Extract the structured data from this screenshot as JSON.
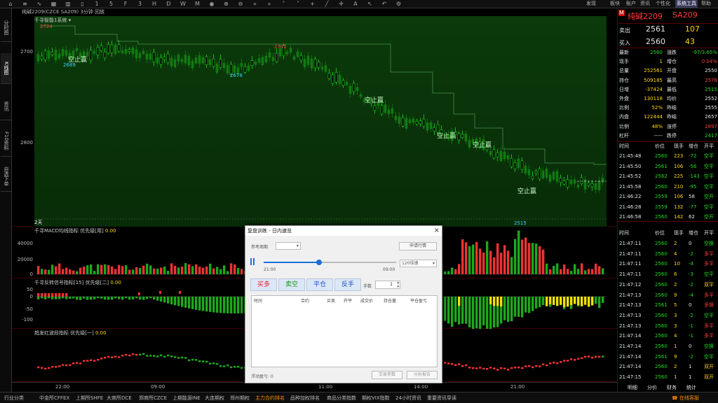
{
  "toolbar": {
    "top_menu": [
      "发现",
      "板块",
      "账户",
      "资讯",
      "个性化",
      "系统工具",
      "帮助"
    ],
    "active_menu": "系统工具"
  },
  "titlebar": {
    "text": "纯碱2209(CZCE SA209)  3分钟  回放"
  },
  "left_tabs": [
    "分时图",
    "K线图",
    "资讯",
    "F10资料",
    "自选下单"
  ],
  "main_pane": {
    "title": "千寻智能1系统",
    "y_ticks": [
      "2700",
      "2800"
    ],
    "period_label": "2天",
    "annotations": [
      {
        "text": "2724",
        "color": "red"
      },
      {
        "text": "2689",
        "color": "cyan"
      },
      {
        "text": "2702",
        "color": "red"
      },
      {
        "text": "2678",
        "color": "cyan"
      },
      {
        "text": "2515",
        "color": "cyan"
      }
    ],
    "trade_labels": [
      "空止赢",
      "空止赢",
      "空止赢",
      "空止赢",
      "空止赢"
    ]
  },
  "macd_pane": {
    "title": "千寻MACD均线指标",
    "suffix": "优先级[用]",
    "value": "0.00",
    "y_ticks": [
      "40000",
      "20000",
      "0"
    ]
  },
  "signal_pane": {
    "title": "千寻反转信号指标[15]",
    "suffix": "优先级[二]",
    "value": "0.00",
    "y_ticks": [
      "50",
      "0",
      "-50",
      "-100"
    ]
  },
  "dist_pane": {
    "title": "趋发红波段指标",
    "suffix": "优先级[一]",
    "value": "0.00"
  },
  "x_axis": [
    "22:00",
    "09:00",
    "11:00",
    "14:00",
    "21:00"
  ],
  "status_bar": {
    "items": [
      "行业分类",
      "中金所CFFEX",
      "上期所SHFE",
      "大商所DCE",
      "郑商所CZCE",
      "上期能源INE",
      "大连期权",
      "郑州期权",
      "主力合约排名",
      "品种加权排名",
      "商品分类指数",
      "期权VIX指数",
      "24小时资讯",
      "重要资讯导读"
    ],
    "highlight": "主力合约排名",
    "right_label": "在线客服"
  },
  "quote": {
    "badge": "M",
    "name": "纯碱2209",
    "code": "SA209",
    "ask_label": "卖出",
    "ask_price": "2561",
    "ask_vol": "107",
    "bid_label": "买入",
    "bid_price": "2560",
    "bid_vol": "43",
    "stats": [
      {
        "l1": "最新",
        "v1": "2560",
        "l2": "涨跌",
        "v2": "-97/3.65%"
      },
      {
        "l1": "现手",
        "v1": "1",
        "l2": "增仓",
        "v2": "0.04%"
      },
      {
        "l1": "总量",
        "v1": "252561",
        "l2": "开盘",
        "v2": "2550"
      },
      {
        "l1": "持仓",
        "v1": "509185",
        "l2": "最高",
        "v2": "2576"
      },
      {
        "l1": "日增",
        "v1": "-37424",
        "l2": "最低",
        "v2": "2515"
      },
      {
        "l1": "外盘",
        "v1": "130118",
        "l2": "均价",
        "v2": "2552"
      },
      {
        "l1": "比例",
        "v1": "52%",
        "l2": "昨结",
        "v2": "2555"
      },
      {
        "l1": "内盘",
        "v1": "122444",
        "l2": "昨结",
        "v2": "2657"
      },
      {
        "l1": "比例",
        "v1": "48%",
        "l2": "涨停",
        "v2": "2897"
      },
      {
        "l1": "杠杆",
        "v1": "-----",
        "l2": "跌停",
        "v2": "2417"
      }
    ],
    "ticks_header": [
      "时间",
      "价位",
      "现手",
      "增仓",
      "开平"
    ],
    "ticks_a": [
      [
        "21:45:48",
        "2560",
        "223",
        "-72",
        "空平"
      ],
      [
        "21:45:50",
        "2561",
        "106",
        "-56",
        "空平"
      ],
      [
        "21:45:52",
        "2562",
        "225",
        "-143",
        "空平"
      ],
      [
        "21:45:58",
        "2560",
        "210",
        "-95",
        "空平"
      ],
      [
        "21:46:22",
        "2559",
        "106",
        "58",
        "空开"
      ],
      [
        "21:46:28",
        "2559",
        "132",
        "-77",
        "空平"
      ],
      [
        "21:46:58",
        "2560",
        "142",
        "62",
        "空开"
      ]
    ],
    "ticks_b": [
      [
        "21:47:11",
        "2560",
        "2",
        "0",
        "空换"
      ],
      [
        "21:47:11",
        "2560",
        "4",
        "-2",
        "多平"
      ],
      [
        "21:47:11",
        "2560",
        "10",
        "-4",
        "多平"
      ],
      [
        "21:47:11",
        "2560",
        "6",
        "-3",
        "空平"
      ],
      [
        "21:47:12",
        "2560",
        "2",
        "-2",
        "双平"
      ],
      [
        "21:47:13",
        "2560",
        "9",
        "-4",
        "多平"
      ],
      [
        "21:47:13",
        "2561",
        "5",
        "0",
        "多换"
      ],
      [
        "21:47:13",
        "2560",
        "3",
        "-2",
        "空平"
      ],
      [
        "21:47:13",
        "2560",
        "3",
        "-1",
        "多平"
      ],
      [
        "21:47:14",
        "2560",
        "4",
        "-1",
        "多平"
      ],
      [
        "21:47:14",
        "2560",
        "1",
        "0",
        "空换"
      ],
      [
        "21:47:14",
        "2561",
        "9",
        "-2",
        "空平"
      ],
      [
        "21:47:14",
        "2560",
        "2",
        "1",
        "双开"
      ],
      [
        "21:47:15",
        "2560",
        "1",
        "1",
        "双开"
      ]
    ],
    "bottom_tabs": [
      "明细",
      "分价",
      "财务",
      "统计"
    ]
  },
  "dialog": {
    "title": "复盘训练 - 日内速览",
    "period_label": "参考周期",
    "apply_btn": "申请行情",
    "time_start": "21:00",
    "time_end": "09:00",
    "speed": "120倍速",
    "progress": 0.42,
    "buttons": [
      "买多",
      "卖空",
      "平仓",
      "反手"
    ],
    "qty_label": "手数",
    "qty": "1",
    "table_headers": [
      "时间",
      "合约",
      "买卖",
      "开平",
      "成交价",
      "持仓量",
      "平仓盈亏"
    ],
    "float_label": "浮动盈亏:",
    "float_value": "0",
    "btn_params": "交易参数",
    "btn_report": "分析报告"
  }
}
